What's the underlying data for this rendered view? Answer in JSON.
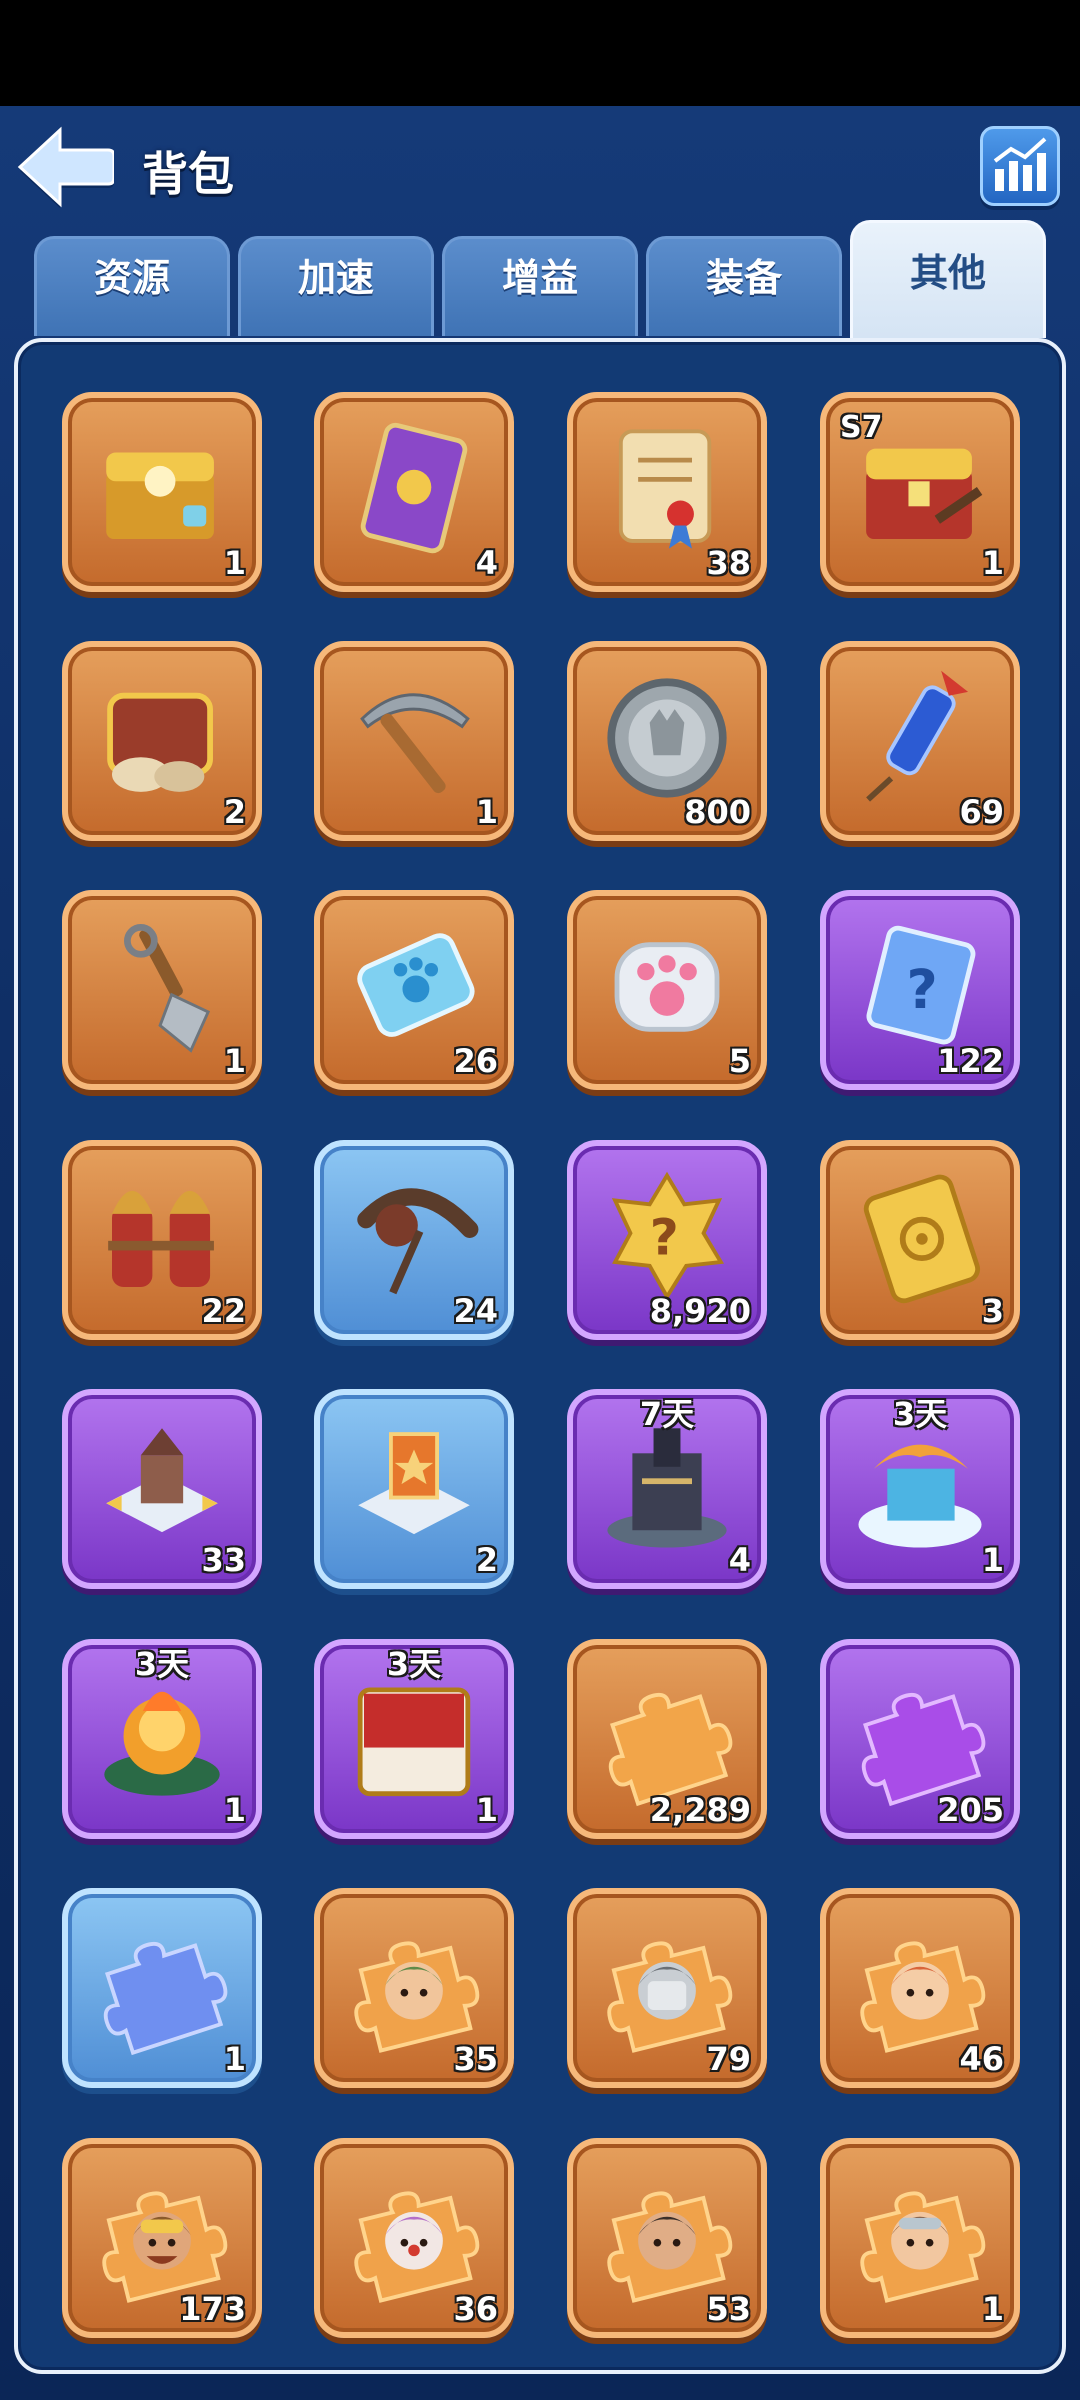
{
  "header": {
    "title": "背包"
  },
  "tabs": [
    {
      "label": "资源",
      "active": false
    },
    {
      "label": "加速",
      "active": false
    },
    {
      "label": "增益",
      "active": false
    },
    {
      "label": "装备",
      "active": false
    },
    {
      "label": "其他",
      "active": true
    }
  ],
  "items": [
    {
      "icon": "treasure-chest-paw",
      "count": "1",
      "rarity": "orange"
    },
    {
      "icon": "purple-card",
      "count": "4",
      "rarity": "orange"
    },
    {
      "icon": "scroll-ribbon",
      "count": "38",
      "rarity": "orange"
    },
    {
      "icon": "s7-treasure-chest",
      "count": "1",
      "rarity": "orange",
      "tag": "S7"
    },
    {
      "icon": "open-chest-sacks",
      "count": "2",
      "rarity": "orange"
    },
    {
      "icon": "pickaxe",
      "count": "1",
      "rarity": "orange"
    },
    {
      "icon": "silver-coin-wolf",
      "count": "800",
      "rarity": "orange"
    },
    {
      "icon": "blue-firework-rocket",
      "count": "69",
      "rarity": "orange"
    },
    {
      "icon": "shovel",
      "count": "1",
      "rarity": "orange"
    },
    {
      "icon": "paw-ticket",
      "count": "26",
      "rarity": "orange"
    },
    {
      "icon": "paw-token",
      "count": "5",
      "rarity": "orange"
    },
    {
      "icon": "mystery-card",
      "count": "122",
      "rarity": "purple"
    },
    {
      "icon": "twin-rockets",
      "count": "22",
      "rarity": "orange"
    },
    {
      "icon": "grappling-hook",
      "count": "24",
      "rarity": "blue"
    },
    {
      "icon": "mystery-badge",
      "count": "8,920",
      "rarity": "purple"
    },
    {
      "icon": "target-ticket",
      "count": "3",
      "rarity": "orange"
    },
    {
      "icon": "relocate-castle",
      "count": "33",
      "rarity": "purple"
    },
    {
      "icon": "relocate-banner",
      "count": "2",
      "rarity": "blue"
    },
    {
      "icon": "dark-castle-skin",
      "count": "4",
      "rarity": "purple",
      "days": "7天"
    },
    {
      "icon": "dragon-castle-skin",
      "count": "1",
      "rarity": "purple",
      "days": "3天"
    },
    {
      "icon": "fire-castle-skin",
      "count": "1",
      "rarity": "purple",
      "days": "3天"
    },
    {
      "icon": "nameplate-frame",
      "count": "1",
      "rarity": "purple",
      "days": "3天"
    },
    {
      "icon": "orange-puzzle-piece",
      "count": "2,289",
      "rarity": "orange"
    },
    {
      "icon": "purple-puzzle-piece",
      "count": "205",
      "rarity": "purple"
    },
    {
      "icon": "blue-puzzle-piece",
      "count": "1",
      "rarity": "blue"
    },
    {
      "icon": "hero-puzzle-hooded-girl",
      "count": "35",
      "rarity": "orange"
    },
    {
      "icon": "hero-puzzle-masked",
      "count": "79",
      "rarity": "orange"
    },
    {
      "icon": "hero-puzzle-red-hair-girl",
      "count": "46",
      "rarity": "orange"
    },
    {
      "icon": "hero-puzzle-pilot",
      "count": "173",
      "rarity": "orange"
    },
    {
      "icon": "hero-puzzle-clown",
      "count": "36",
      "rarity": "orange"
    },
    {
      "icon": "hero-puzzle-bandana-man",
      "count": "53",
      "rarity": "orange"
    },
    {
      "icon": "hero-puzzle-goggles-girl",
      "count": "1",
      "rarity": "orange"
    }
  ]
}
